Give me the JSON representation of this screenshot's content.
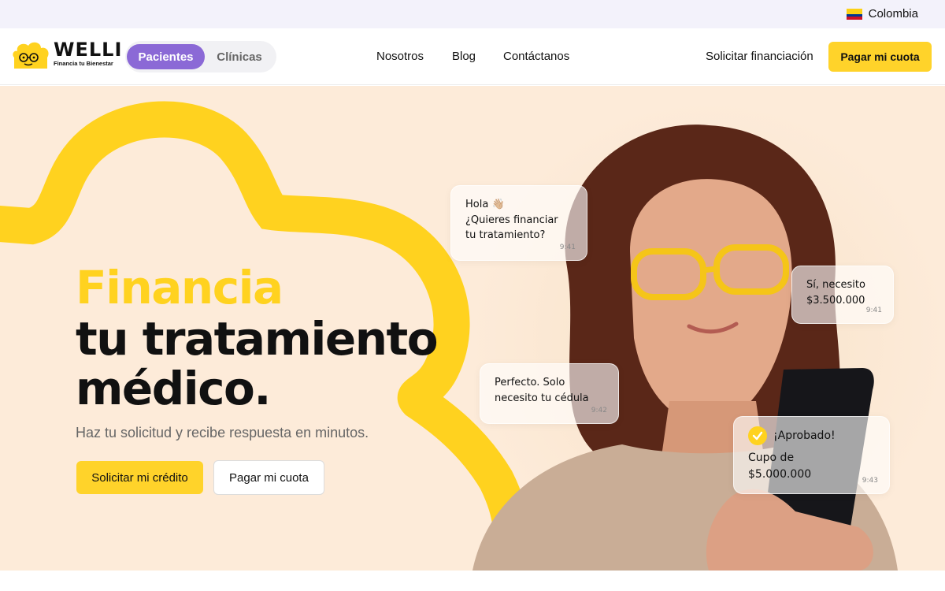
{
  "topbar": {
    "country": "Colombia",
    "flag_colors": [
      "#fcd116",
      "#003893",
      "#ce1126"
    ]
  },
  "nav": {
    "logo_word": "WELLI",
    "logo_tagline": "Financia tu Bienestar",
    "segment": {
      "active": "Pacientes",
      "inactive": "Clínicas"
    },
    "links": [
      "Nosotros",
      "Blog",
      "Contáctanos"
    ],
    "request_link": "Solicitar financiación",
    "pay_button": "Pagar mi cuota"
  },
  "hero": {
    "headline_accent": "Financia",
    "headline_line2": "tu tratamiento",
    "headline_line3": "médico.",
    "subtitle": "Haz tu solicitud y recibe respuesta en minutos.",
    "primary_cta": "Solicitar mi crédito",
    "secondary_cta": "Pagar mi cuota"
  },
  "chat": [
    {
      "lines": [
        "Hola 👋🏼",
        "¿Quieres financiar",
        "tu tratamiento?"
      ],
      "time": "9:41"
    },
    {
      "lines": [
        "Sí, necesito",
        "$3.500.000"
      ],
      "time": "9:41"
    },
    {
      "lines": [
        "Perfecto. Solo",
        "necesito tu cédula"
      ],
      "time": "9:42"
    },
    {
      "title": "¡Aprobado!",
      "lines": [
        "Cupo de",
        "$5.000.000"
      ],
      "time": "9:43"
    }
  ],
  "colors": {
    "brand_yellow": "#ffd21f",
    "segment_purple": "#8b69d6",
    "hero_background": "#fdebd9"
  }
}
